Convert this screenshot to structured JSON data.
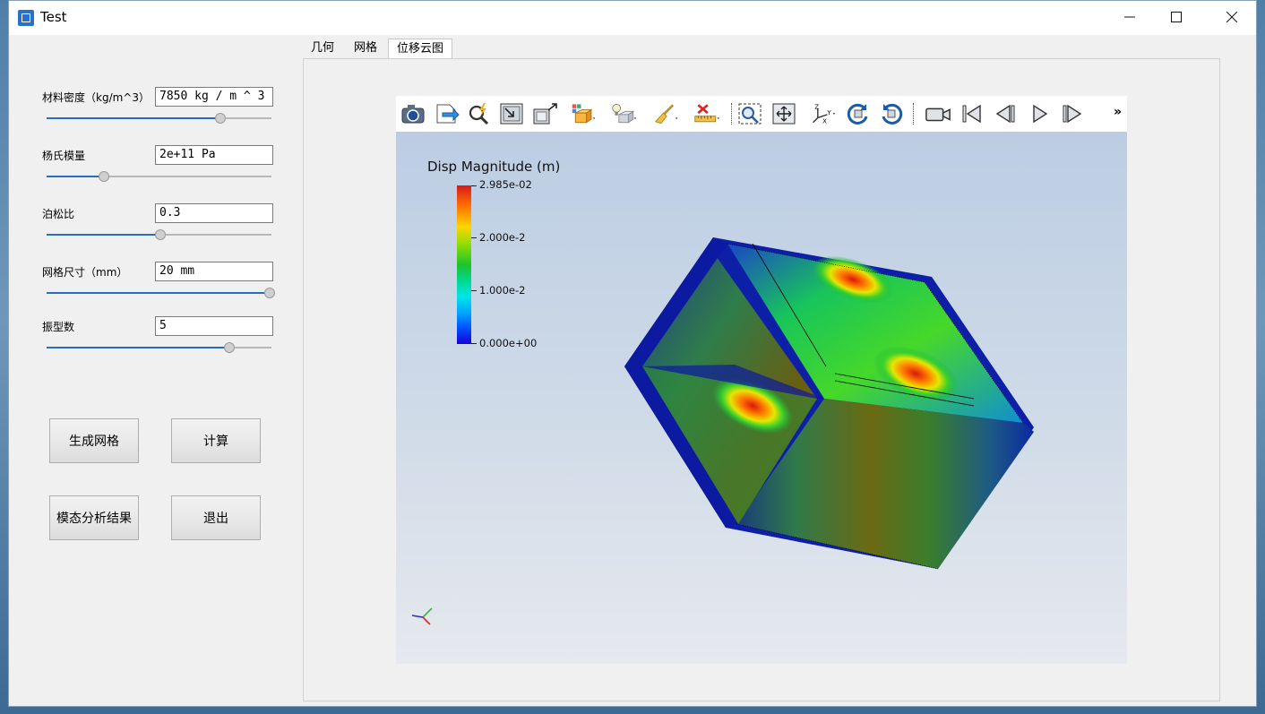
{
  "window": {
    "title": "Test",
    "min_label": "—",
    "max_label": "☐",
    "close_label": "✕"
  },
  "params": [
    {
      "label": "材料密度（kg/m^3）",
      "value": "7850 kg / m ^ 3",
      "slider": 0.77
    },
    {
      "label": "杨氏模量",
      "value": "2e+11 Pa",
      "slider": 0.25
    },
    {
      "label": "泊松比",
      "value": "0.3",
      "slider": 0.5
    },
    {
      "label": "网格尺寸（mm）",
      "value": "20 mm",
      "slider": 0.99
    },
    {
      "label": "振型数",
      "value": "5",
      "slider": 0.81
    }
  ],
  "buttons": {
    "generate_mesh": "生成网格",
    "compute": "计算",
    "modal_results": "模态分析结果",
    "exit": "退出"
  },
  "tabs": [
    {
      "label": "几何",
      "active": false
    },
    {
      "label": "网格",
      "active": false
    },
    {
      "label": "位移云图",
      "active": true
    }
  ],
  "toolbar": {
    "icons": [
      "camera-icon",
      "export-icon",
      "interactive-select-icon",
      "reset-camera-icon",
      "zoom-to-data-icon",
      "color-map-icon",
      "lighting-icon",
      "paint-brush-icon",
      "ruler-icon",
      "zoom-box-icon",
      "pan-icon",
      "axes-orientation-icon",
      "rotate-cw-icon",
      "rotate-ccw-icon",
      "video-camera-icon",
      "first-frame-icon",
      "prev-frame-icon",
      "play-icon",
      "last-frame-icon"
    ],
    "more_label": "»"
  },
  "colorbar": {
    "title": "Disp Magnitude (m)",
    "labels": [
      "2.985e-02",
      "2.000e-2",
      "1.000e-2",
      "0.000e+00"
    ],
    "colors": [
      "#d7191c",
      "#ffd400",
      "#1ec32b",
      "#00e6e6",
      "#1a00d6"
    ]
  }
}
